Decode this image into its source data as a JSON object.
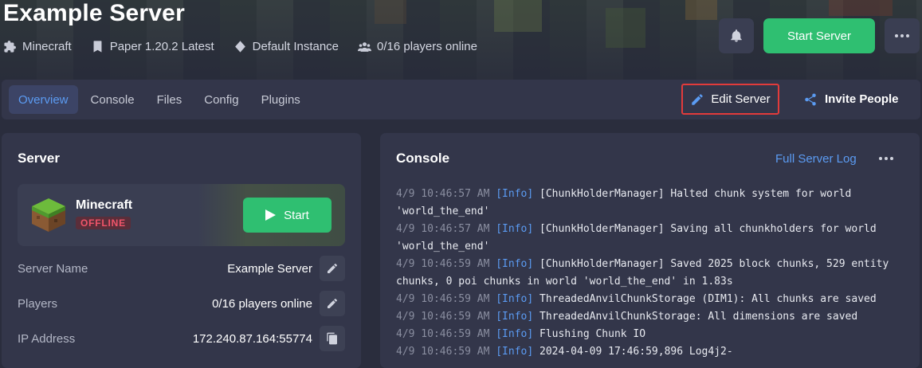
{
  "header": {
    "title": "Example Server",
    "meta": [
      {
        "icon": "puzzle-icon",
        "label": "Minecraft"
      },
      {
        "icon": "bookmark-icon",
        "label": "Paper 1.20.2 Latest"
      },
      {
        "icon": "diamond-icon",
        "label": "Default Instance"
      },
      {
        "icon": "users-icon",
        "label": "0/16 players online"
      }
    ],
    "start_label": "Start Server"
  },
  "tabs": [
    {
      "label": "Overview",
      "active": true
    },
    {
      "label": "Console",
      "active": false
    },
    {
      "label": "Files",
      "active": false
    },
    {
      "label": "Config",
      "active": false
    },
    {
      "label": "Plugins",
      "active": false
    }
  ],
  "actions": {
    "edit_label": "Edit Server",
    "invite_label": "Invite People"
  },
  "server": {
    "title": "Server",
    "game": "Minecraft",
    "status": "OFFLINE",
    "start_label": "Start",
    "rows": [
      {
        "label": "Server Name",
        "value": "Example Server",
        "icon": "pencil-icon"
      },
      {
        "label": "Players",
        "value": "0/16 players online",
        "icon": "pencil-icon"
      },
      {
        "label": "IP Address",
        "value": "172.240.87.164:55774",
        "icon": "copy-icon"
      }
    ]
  },
  "console": {
    "title": "Console",
    "full_log_label": "Full Server Log",
    "entries": [
      {
        "time": "4/9 10:46:57 AM",
        "level": "[Info]",
        "msg": "[ChunkHolderManager] Halted chunk system for world",
        "cont": "'world_the_end'"
      },
      {
        "time": "4/9 10:46:57 AM",
        "level": "[Info]",
        "msg": "[ChunkHolderManager] Saving all chunkholders for world",
        "cont": "'world_the_end'"
      },
      {
        "time": "4/9 10:46:59 AM",
        "level": "[Info]",
        "msg": "[ChunkHolderManager] Saved 2025 block chunks, 529 entity",
        "cont": "chunks, 0 poi chunks in world 'world_the_end' in 1.83s"
      },
      {
        "time": "4/9 10:46:59 AM",
        "level": "[Info]",
        "msg": "ThreadedAnvilChunkStorage (DIM1): All chunks are saved",
        "cont": ""
      },
      {
        "time": "4/9 10:46:59 AM",
        "level": "[Info]",
        "msg": "ThreadedAnvilChunkStorage: All dimensions are saved",
        "cont": ""
      },
      {
        "time": "4/9 10:46:59 AM",
        "level": "[Info]",
        "msg": "Flushing Chunk IO",
        "cont": ""
      },
      {
        "time": "4/9 10:46:59 AM",
        "level": "[Info]",
        "msg": "2024-04-09 17:46:59,896 Log4j2-",
        "cont": ""
      }
    ]
  }
}
